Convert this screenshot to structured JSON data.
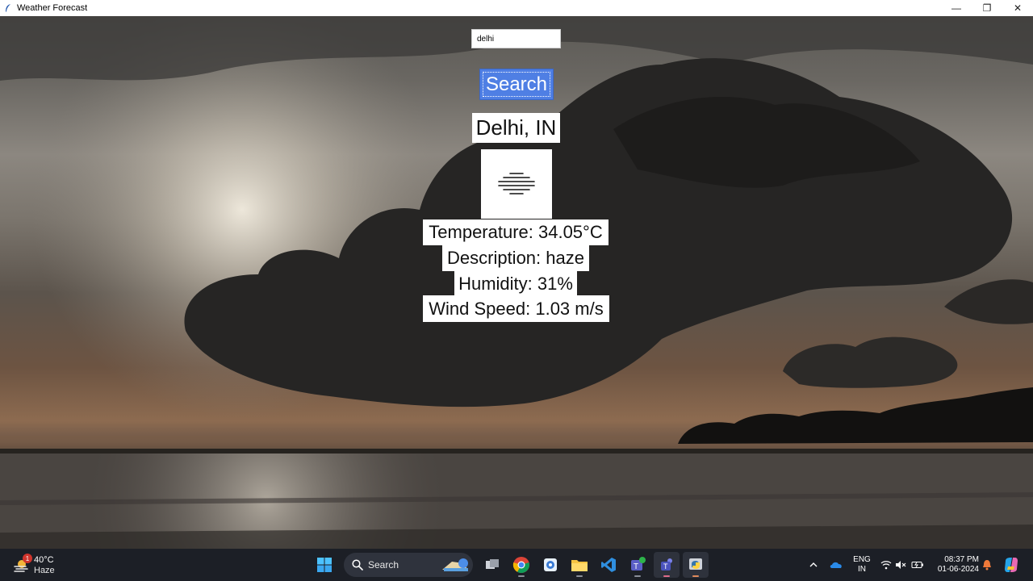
{
  "window": {
    "title": "Weather Forecast",
    "minimize_glyph": "—",
    "maximize_glyph": "❐",
    "close_glyph": "✕"
  },
  "search": {
    "value": "delhi",
    "button_label": "Search"
  },
  "weather": {
    "location": "Delhi, IN",
    "icon": "haze-icon",
    "temperature_text": "Temperature: 34.05°C",
    "description_text": "Description: haze",
    "humidity_text": "Humidity: 31%",
    "wind_text": "Wind Speed: 1.03 m/s"
  },
  "taskbar": {
    "weather_widget": {
      "temp": "40°C",
      "condition": "Haze",
      "badge": "1"
    },
    "search_label": "Search",
    "apps": [
      "windows-start-icon",
      "search-icon",
      "copilot-icon",
      "task-view-icon",
      "chrome-icon",
      "photos-icon",
      "file-explorer-icon",
      "vscode-icon",
      "teams-icon",
      "teams-work-icon",
      "python-icon"
    ],
    "language": {
      "line1": "ENG",
      "line2": "IN"
    },
    "clock": {
      "time": "08:37 PM",
      "date": "01-06-2024"
    }
  },
  "colors": {
    "search_button": "#4f7fe4",
    "taskbar": "#1c1f26"
  }
}
